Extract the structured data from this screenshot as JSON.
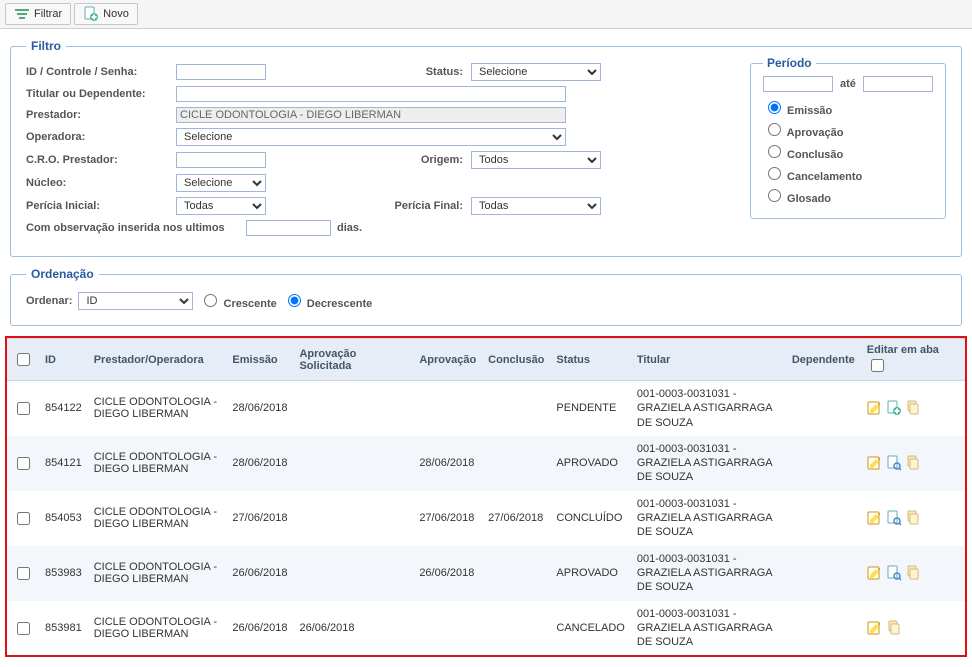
{
  "toolbar": {
    "filtrar": "Filtrar",
    "novo": "Novo"
  },
  "filtro": {
    "legend": "Filtro",
    "id_label": "ID / Controle / Senha:",
    "status_label": "Status:",
    "status_value": "Selecione",
    "titular_label": "Titular ou Dependente:",
    "prestador_label": "Prestador:",
    "prestador_value": "CICLE ODONTOLOGIA - DIEGO LIBERMAN",
    "operadora_label": "Operadora:",
    "operadora_value": "Selecione",
    "cro_label": "C.R.O. Prestador:",
    "origem_label": "Origem:",
    "origem_value": "Todos",
    "nucleo_label": "Núcleo:",
    "nucleo_value": "Selecione",
    "pinicial_label": "Perícia Inicial:",
    "pinicial_value": "Todas",
    "pfinal_label": "Perícia Final:",
    "pfinal_value": "Todas",
    "obs_label": "Com observação inserida nos ultimos",
    "obs_suffix": "dias."
  },
  "periodo": {
    "legend": "Período",
    "ate": "até",
    "options": [
      "Emissão",
      "Aprovação",
      "Conclusão",
      "Cancelamento",
      "Glosado"
    ],
    "selected": 0
  },
  "ordenacao": {
    "legend": "Ordenação",
    "label": "Ordenar:",
    "value": "ID",
    "cresc": "Crescente",
    "decresc": "Decrescente",
    "selected": "decresc"
  },
  "grid": {
    "headers": {
      "id": "ID",
      "prestador": "Prestador/Operadora",
      "emissao": "Emissão",
      "apr_sol": "Aprovação Solicitada",
      "aprovacao": "Aprovação",
      "conclusao": "Conclusão",
      "status": "Status",
      "titular": "Titular",
      "dependente": "Dependente",
      "editar": "Editar em aba"
    },
    "rows": [
      {
        "id": "854122",
        "prestador": "CICLE ODONTOLOGIA - DIEGO LIBERMAN",
        "emissao": "28/06/2018",
        "apr_sol": "",
        "aprovacao": "",
        "conclusao": "",
        "status": "PENDENTE",
        "titular": "001-0003-0031031 - GRAZIELA ASTIGARRAGA DE SOUZA",
        "dependente": "",
        "icons": [
          "edit",
          "page-add",
          "copy"
        ]
      },
      {
        "id": "854121",
        "prestador": "CICLE ODONTOLOGIA - DIEGO LIBERMAN",
        "emissao": "28/06/2018",
        "apr_sol": "",
        "aprovacao": "28/06/2018",
        "conclusao": "",
        "status": "APROVADO",
        "titular": "001-0003-0031031 - GRAZIELA ASTIGARRAGA DE SOUZA",
        "dependente": "",
        "icons": [
          "edit",
          "page-search",
          "copy"
        ]
      },
      {
        "id": "854053",
        "prestador": "CICLE ODONTOLOGIA - DIEGO LIBERMAN",
        "emissao": "27/06/2018",
        "apr_sol": "",
        "aprovacao": "27/06/2018",
        "conclusao": "27/06/2018",
        "status": "CONCLUÍDO",
        "titular": "001-0003-0031031 - GRAZIELA ASTIGARRAGA DE SOUZA",
        "dependente": "",
        "icons": [
          "edit",
          "page-search",
          "copy"
        ]
      },
      {
        "id": "853983",
        "prestador": "CICLE ODONTOLOGIA - DIEGO LIBERMAN",
        "emissao": "26/06/2018",
        "apr_sol": "",
        "aprovacao": "26/06/2018",
        "conclusao": "",
        "status": "APROVADO",
        "titular": "001-0003-0031031 - GRAZIELA ASTIGARRAGA DE SOUZA",
        "dependente": "",
        "icons": [
          "edit",
          "page-search",
          "copy"
        ]
      },
      {
        "id": "853981",
        "prestador": "CICLE ODONTOLOGIA - DIEGO LIBERMAN",
        "emissao": "26/06/2018",
        "apr_sol": "26/06/2018",
        "aprovacao": "",
        "conclusao": "",
        "status": "CANCELADO",
        "titular": "001-0003-0031031 - GRAZIELA ASTIGARRAGA DE SOUZA",
        "dependente": "",
        "icons": [
          "edit",
          "copy"
        ]
      }
    ]
  }
}
